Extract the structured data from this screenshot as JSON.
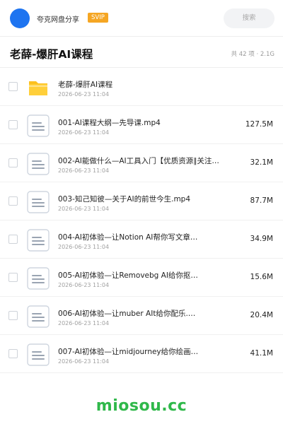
{
  "header": {
    "share_name": "夸克网盘分享",
    "badge": "SVIP",
    "search_placeholder": "搜索"
  },
  "titlebar": {
    "title": "老薛-爆肝AI课程",
    "meta": "共 42 项 · 2.1G"
  },
  "colors": {
    "accent_blue": "#1e74f0",
    "badge_orange": "#f5a623",
    "folder_yellow": "#fcc01f",
    "watermark_green": "#2fb84a"
  },
  "files": [
    {
      "type": "folder-icon",
      "name": "老薛-爆肝AI课程",
      "date": "2026-06-23 11:04",
      "size": ""
    },
    {
      "type": "video-file-icon",
      "name": "001-AI课程大纲—先导课.mp4",
      "date": "2026-06-23 11:04",
      "size": "127.5M"
    },
    {
      "type": "video-file-icon",
      "name": "002-AI能做什么—AI工具入门【优质资源∥关注…",
      "date": "2026-06-23 11:04",
      "size": "32.1M"
    },
    {
      "type": "video-file-icon",
      "name": "003-知己知彼—关于AI的前世今生.mp4",
      "date": "2026-06-23 11:04",
      "size": "87.7M"
    },
    {
      "type": "video-file-icon",
      "name": "004-AI初体验—让Notion AI帮你写文章…",
      "date": "2026-06-23 11:04",
      "size": "34.9M"
    },
    {
      "type": "video-file-icon",
      "name": "005-AI初体验—让Removebg AI给你抠…",
      "date": "2026-06-23 11:04",
      "size": "15.6M"
    },
    {
      "type": "video-file-icon",
      "name": "006-AI初体验—让muber AIt给你配乐.…",
      "date": "2026-06-23 11:04",
      "size": "20.4M"
    },
    {
      "type": "video-file-icon",
      "name": "007-AI初体验—让midjourney给你绘画…",
      "date": "2026-06-23 11:04",
      "size": "41.1M"
    }
  ],
  "footer": {
    "watermark": "miosou.cc"
  }
}
